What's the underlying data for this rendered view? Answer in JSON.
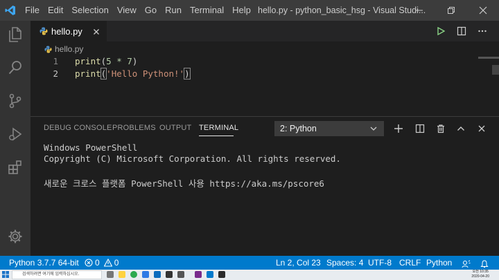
{
  "titlebar": {
    "menu": [
      "File",
      "Edit",
      "Selection",
      "View",
      "Go",
      "Run",
      "Terminal",
      "Help"
    ],
    "window_title": "hello.py - python_basic_hsg - Visual Studi..."
  },
  "tab": {
    "label": "hello.py"
  },
  "breadcrumb": {
    "file": "hello.py"
  },
  "editor": {
    "lines": [
      {
        "num": "1",
        "fn": "print",
        "open": "(",
        "arg": "5 * 7",
        "close": ")"
      },
      {
        "num": "2",
        "fn": "print",
        "open": "(",
        "arg": "'Hello Python!'",
        "close": ")"
      }
    ]
  },
  "panel": {
    "tabs": [
      "DEBUG CONSOLE",
      "PROBLEMS",
      "OUTPUT",
      "TERMINAL"
    ],
    "active_tab": "TERMINAL",
    "terminal_select": "2: Python",
    "output": [
      "Windows PowerShell",
      "Copyright (C) Microsoft Corporation. All rights reserved.",
      "",
      "새로운 크로스 플랫폼 PowerShell 사용 https://aka.ms/pscore6"
    ]
  },
  "statusbar": {
    "interpreter": "Python 3.7.7 64-bit",
    "errors": "0",
    "warnings": "0",
    "position": "Ln 2, Col 23",
    "spaces": "Spaces: 4",
    "encoding": "UTF-8",
    "eol": "CRLF",
    "language": "Python"
  },
  "taskbar": {
    "search_placeholder": "검색하려면 여기에 입력하십시오.",
    "time": "오전 10:35",
    "date": "2020-04-20"
  },
  "colors": {
    "accent": "#007acc",
    "titlebar": "#3c3c3c",
    "activitybar": "#333333",
    "editor_bg": "#1e1e1e"
  }
}
